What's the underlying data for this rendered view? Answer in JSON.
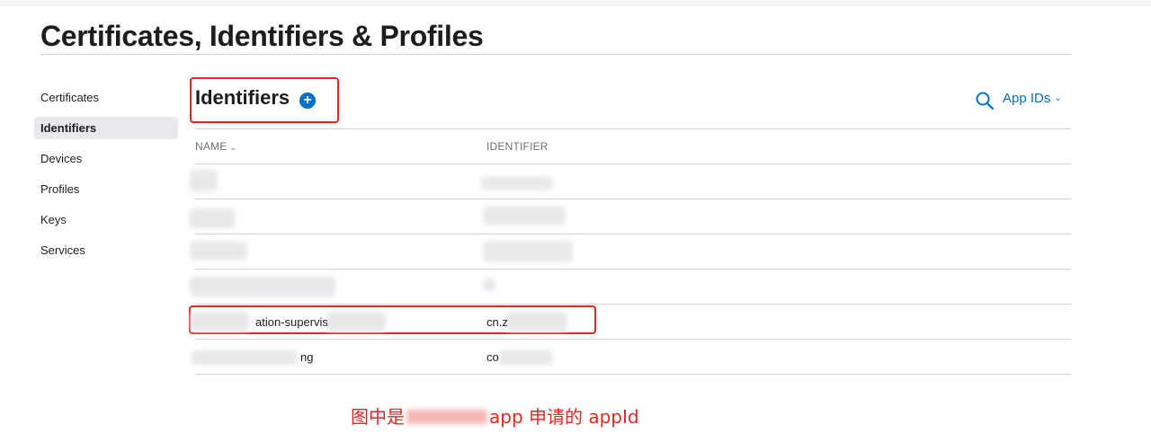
{
  "page_title": "Certificates, Identifiers & Profiles",
  "sidebar": {
    "items": [
      {
        "label": "Certificates"
      },
      {
        "label": "Identifiers",
        "active": true
      },
      {
        "label": "Devices"
      },
      {
        "label": "Profiles"
      },
      {
        "label": "Keys"
      },
      {
        "label": "Services"
      }
    ]
  },
  "section": {
    "title": "Identifiers",
    "add_icon": "plus-circle-icon",
    "search_icon": "search-icon",
    "filter_label": "App IDs"
  },
  "table": {
    "headers": {
      "name": "NAME",
      "identifier": "IDENTIFIER"
    },
    "rows": [
      {
        "name": "",
        "identifier": ""
      },
      {
        "name": "",
        "identifier": ""
      },
      {
        "name": "",
        "identifier": ""
      },
      {
        "name": "",
        "identifier": ""
      },
      {
        "name": "ation-supervis",
        "identifier": "cn.z"
      },
      {
        "name": "ng",
        "identifier": "co"
      }
    ]
  },
  "annotation": {
    "prefix": "图中是",
    "suffix": "app 申请的 appId"
  },
  "colors": {
    "accent": "#0070c9",
    "annotation_red": "#e8251f",
    "divider": "#d2d2d7",
    "active_bg": "#e8e8ed"
  }
}
